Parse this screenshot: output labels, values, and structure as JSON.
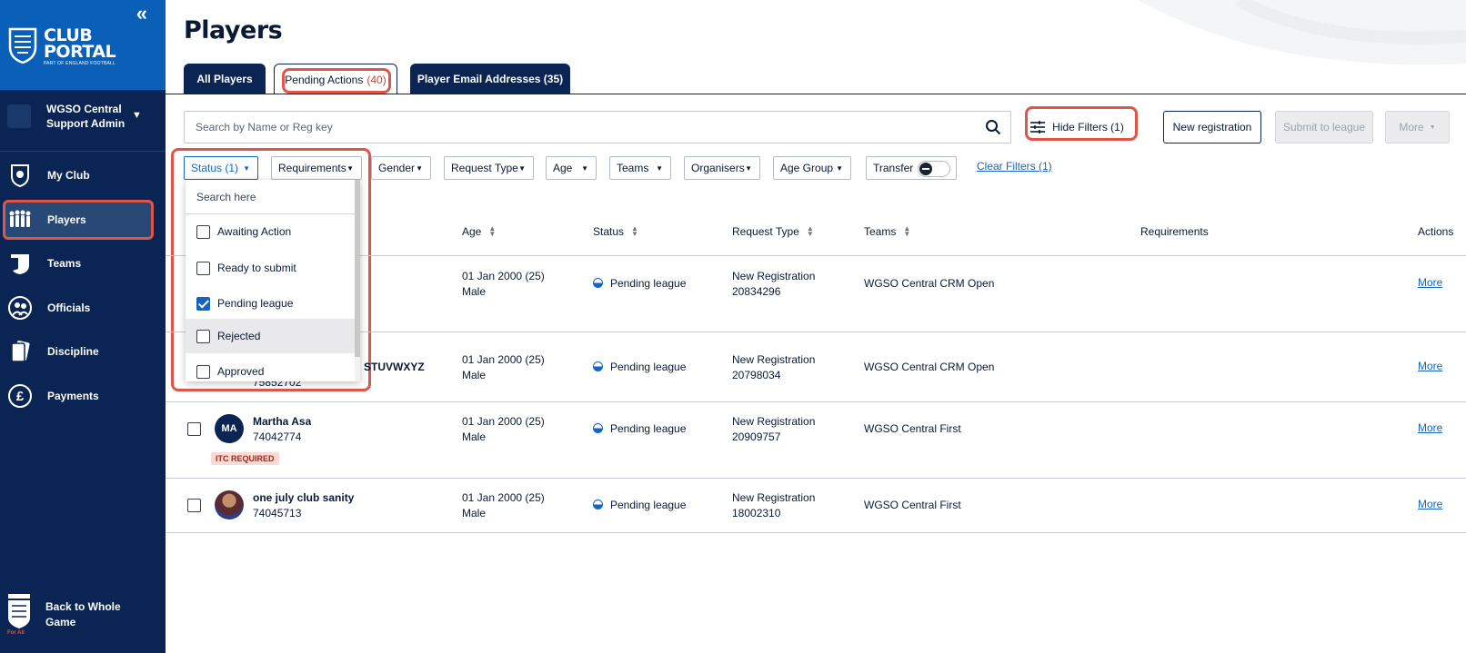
{
  "sidebar": {
    "collapse_glyph": "«",
    "brand_title_1": "CLUB",
    "brand_title_2": "PORTAL",
    "brand_subtitle": "PART OF ENGLAND FOOTBALL",
    "account_line1": "WGSO Central",
    "account_line2": "Support Admin",
    "items": [
      {
        "label": "My Club",
        "icon": "club-badge-icon"
      },
      {
        "label": "Players",
        "icon": "players-icon",
        "active": true
      },
      {
        "label": "Teams",
        "icon": "shirt-icon"
      },
      {
        "label": "Officials",
        "icon": "officials-icon"
      },
      {
        "label": "Discipline",
        "icon": "cards-icon"
      },
      {
        "label": "Payments",
        "icon": "pound-icon"
      }
    ],
    "back_label_1": "Back to Whole",
    "back_label_2": "Game",
    "fa_text": "For All"
  },
  "page": {
    "title": "Players"
  },
  "tabs": [
    {
      "label": "All Players",
      "count": ""
    },
    {
      "label": "Pending Actions",
      "count": "(40)"
    },
    {
      "label": "Player Email Addresses (35)",
      "count": ""
    }
  ],
  "toolbar": {
    "search_placeholder": "Search by Name or Reg key",
    "hide_filters": "Hide Filters (1)",
    "new_registration": "New registration",
    "submit_to_league": "Submit to league",
    "more": "More"
  },
  "filters": {
    "status": "Status (1)",
    "requirements": "Requirements",
    "gender": "Gender",
    "request_type": "Request Type",
    "age": "Age",
    "teams": "Teams",
    "organisers": "Organisers",
    "age_group": "Age Group",
    "transfer": "Transfer",
    "clear": "Clear Filters (1)"
  },
  "dropdown": {
    "search_placeholder": "Search here",
    "options": [
      {
        "label": "Awaiting Action",
        "checked": false
      },
      {
        "label": "Ready to submit",
        "checked": false
      },
      {
        "label": "Pending league",
        "checked": true
      },
      {
        "label": "Rejected",
        "checked": false
      },
      {
        "label": "Approved",
        "checked": false
      }
    ]
  },
  "table": {
    "headers": {
      "age": "Age",
      "status": "Status",
      "request_type": "Request Type",
      "teams": "Teams",
      "requirements": "Requirements",
      "actions": "Actions"
    },
    "rows": [
      {
        "name": "",
        "reg": "",
        "initials": "",
        "dob": "01 Jan 2000 (25)",
        "gender": "Male",
        "status": "Pending league",
        "req_type": "New Registration",
        "req_id": "20834296",
        "team": "WGSO Central CRM Open",
        "more": "More",
        "badge": ""
      },
      {
        "name": "STUVWXYZ",
        "reg": "75852702",
        "initials": "",
        "dob": "01 Jan 2000 (25)",
        "gender": "Male",
        "status": "Pending league",
        "req_type": "New Registration",
        "req_id": "20798034",
        "team": "WGSO Central CRM Open",
        "more": "More",
        "badge": ""
      },
      {
        "name": "Martha Asa",
        "reg": "74042774",
        "initials": "MA",
        "dob": "01 Jan 2000 (25)",
        "gender": "Male",
        "status": "Pending league",
        "req_type": "New Registration",
        "req_id": "20909757",
        "team": "WGSO Central First",
        "more": "More",
        "badge": "ITC REQUIRED"
      },
      {
        "name": "one july club sanity",
        "reg": "74045713",
        "initials": "",
        "dob": "01 Jan 2000 (25)",
        "gender": "Male",
        "status": "Pending league",
        "req_type": "New Registration",
        "req_id": "18002310",
        "team": "WGSO Central First",
        "more": "More",
        "badge": ""
      }
    ]
  },
  "colors": {
    "sidebar": "#0a2553",
    "brand": "#0a60b8",
    "highlight": "#e05547",
    "link": "#1565c0"
  }
}
